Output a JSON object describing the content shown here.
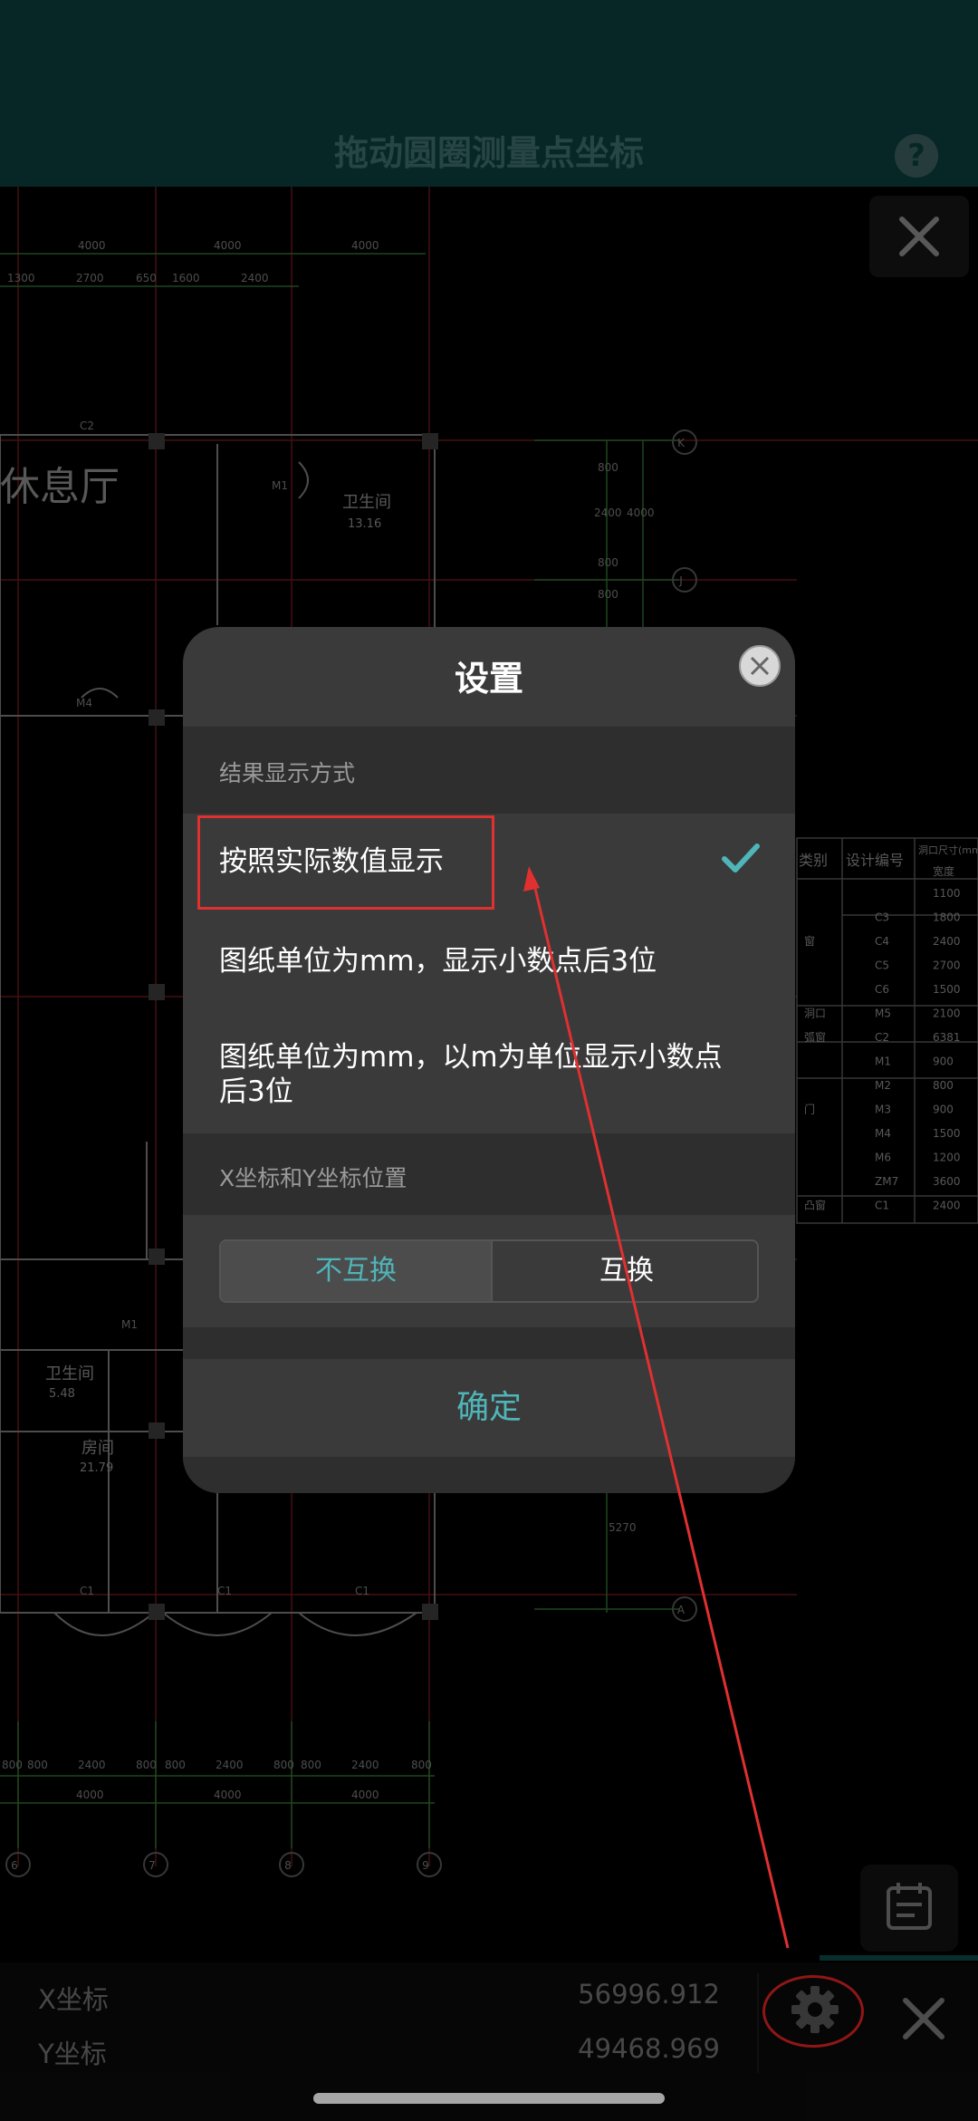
{
  "header": {
    "title": "拖动圆圈测量点坐标",
    "help_label": "?"
  },
  "dialog": {
    "title": "设置",
    "section1_label": "结果显示方式",
    "options": [
      {
        "label": "按照实际数值显示",
        "selected": true
      },
      {
        "label": "图纸单位为mm，显示小数点后3位",
        "selected": false
      },
      {
        "label": "图纸单位为mm，以m为单位显示小数点后3位",
        "selected": false
      }
    ],
    "section2_label": "X坐标和Y坐标位置",
    "segment": {
      "left": "不互换",
      "right": "互换",
      "selected": "left"
    },
    "confirm_label": "确定"
  },
  "bottom_bar": {
    "x_label": "X坐标",
    "x_value": "56996.912",
    "y_label": "Y坐标",
    "y_value": "49468.969"
  },
  "drawing": {
    "top_dims": [
      "4000",
      "4000",
      "4000"
    ],
    "sub_dims": [
      "1300",
      "2700",
      "650",
      "1600",
      "2400"
    ],
    "room_labels": [
      "休息厅",
      "卫生间",
      "13.16",
      "卫生间",
      "5.48",
      "房间",
      "21.79"
    ],
    "grid_labels": [
      "K",
      "J",
      "A",
      "6",
      "7",
      "8",
      "9"
    ],
    "right_dims": [
      "800",
      "2400",
      "4000",
      "800",
      "800",
      "5270"
    ],
    "bottom_dims": [
      "800",
      "800",
      "2400",
      "800",
      "800",
      "2400",
      "800",
      "800",
      "2400",
      "800"
    ],
    "bottom_totals": [
      "4000",
      "4000",
      "4000"
    ],
    "door_labels": [
      "M4",
      "M1",
      "M1",
      "C1",
      "C1",
      "C1",
      "C2"
    ],
    "table_headers": [
      "类别",
      "设计编号",
      "洞口尺寸(mm)",
      "宽度"
    ],
    "table_rows": [
      [
        "",
        "",
        "1100"
      ],
      [
        "",
        "C3",
        "1800"
      ],
      [
        "窗",
        "C4",
        "2400"
      ],
      [
        "",
        "C5",
        "2700"
      ],
      [
        "",
        "C6",
        "1500"
      ],
      [
        "洞口",
        "M5",
        "2100"
      ],
      [
        "弧窗",
        "C2",
        "6381"
      ],
      [
        "",
        "M1",
        "900"
      ],
      [
        "",
        "M2",
        "800"
      ],
      [
        "门",
        "M3",
        "900"
      ],
      [
        "",
        "M4",
        "1500"
      ],
      [
        "",
        "M6",
        "1200"
      ],
      [
        "",
        "ZM7",
        "3600"
      ],
      [
        "凸窗",
        "C1",
        "2400"
      ]
    ]
  },
  "colors": {
    "accent": "#4fb5b9",
    "header_bg": "#0b3c3c",
    "annotation": "#e03030"
  }
}
